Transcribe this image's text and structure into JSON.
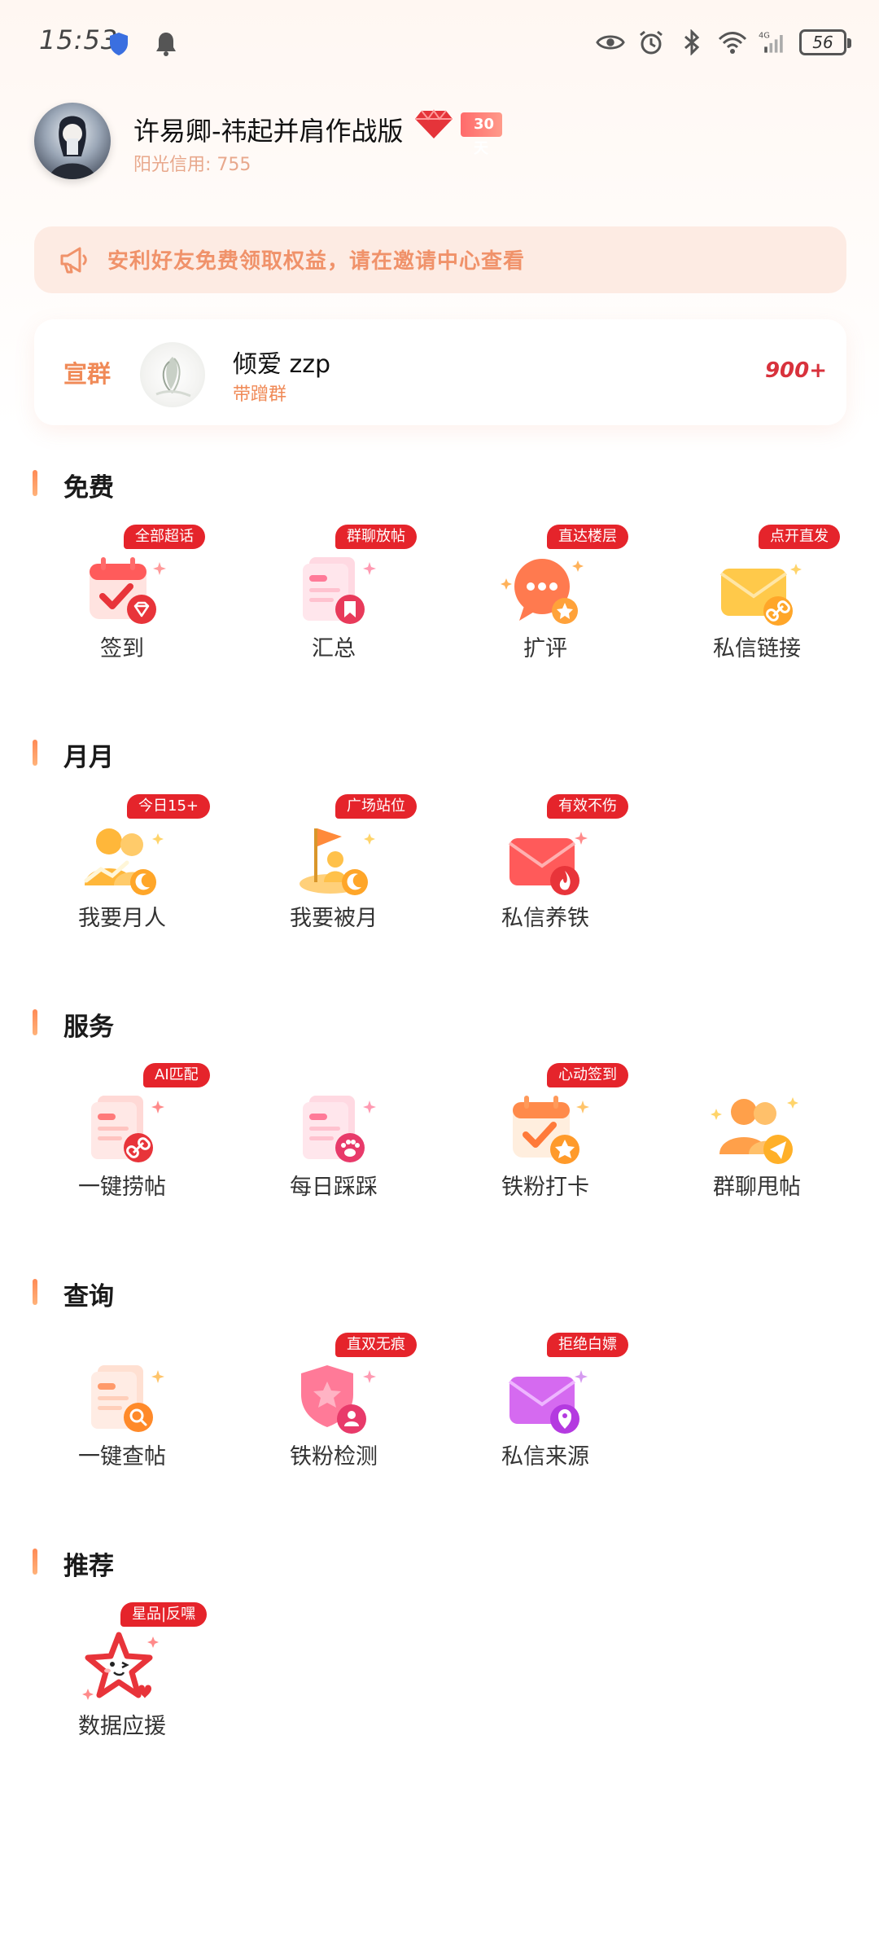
{
  "status_bar": {
    "time": "15:53",
    "battery": "56",
    "network": "4G"
  },
  "profile": {
    "username": "许易卿-祎起并肩作战版",
    "vip_days": "30天",
    "credit": "阳光信用: 755"
  },
  "notice": {
    "text": "安利好友免费领取权益，请在邀请中心查看"
  },
  "group": {
    "tag": "宣群",
    "name": "倾爱 zzp",
    "subtitle": "带蹭群",
    "count": "900+"
  },
  "sections": [
    {
      "title": "免费",
      "items": [
        {
          "label": "签到",
          "badge": "全部超话",
          "icon": "calendar-check-icon"
        },
        {
          "label": "汇总",
          "badge": "群聊放帖",
          "icon": "document-bookmark-icon"
        },
        {
          "label": "扩评",
          "badge": "直达楼层",
          "icon": "chat-bubble-icon"
        },
        {
          "label": "私信链接",
          "badge": "点开直发",
          "icon": "envelope-link-icon"
        }
      ]
    },
    {
      "title": "月月",
      "items": [
        {
          "label": "我要月人",
          "badge": "今日15+",
          "icon": "people-moon-icon"
        },
        {
          "label": "我要被月",
          "badge": "广场站位",
          "icon": "flag-moon-icon"
        },
        {
          "label": "私信养铁",
          "badge": "有效不伤",
          "icon": "envelope-fire-icon"
        }
      ]
    },
    {
      "title": "服务",
      "items": [
        {
          "label": "一键捞帖",
          "badge": "AI匹配",
          "icon": "document-link-icon"
        },
        {
          "label": "每日踩踩",
          "badge": "",
          "icon": "document-paw-icon"
        },
        {
          "label": "铁粉打卡",
          "badge": "心动签到",
          "icon": "calendar-star-icon"
        },
        {
          "label": "群聊甩帖",
          "badge": "",
          "icon": "people-send-icon"
        }
      ]
    },
    {
      "title": "查询",
      "items": [
        {
          "label": "一键查帖",
          "badge": "",
          "icon": "document-search-icon"
        },
        {
          "label": "铁粉检测",
          "badge": "直双无痕",
          "icon": "shield-user-icon"
        },
        {
          "label": "私信来源",
          "badge": "拒绝白嫖",
          "icon": "envelope-location-icon"
        }
      ]
    },
    {
      "title": "推荐",
      "items": [
        {
          "label": "数据应援",
          "badge": "星品|反嘿",
          "icon": "star-face-icon"
        }
      ]
    }
  ],
  "colors": {
    "accent": "#f08a57",
    "badge_red": "#e5242b",
    "count_red": "#d8323c"
  }
}
